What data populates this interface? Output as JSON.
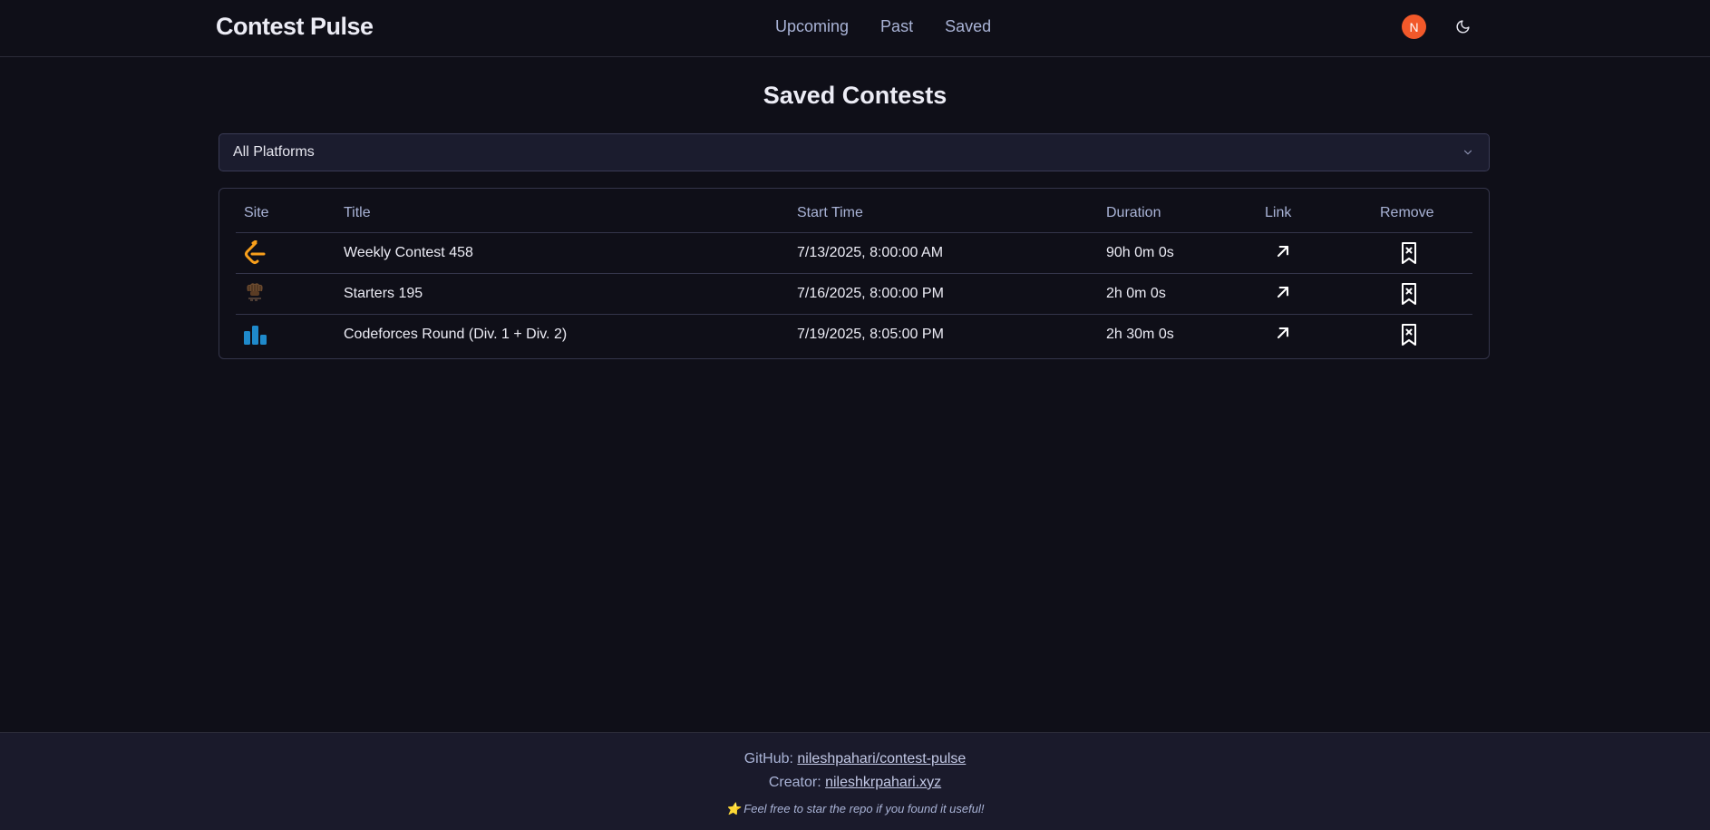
{
  "app": {
    "brand": "Contest Pulse"
  },
  "nav": {
    "items": [
      "Upcoming",
      "Past",
      "Saved"
    ]
  },
  "user": {
    "avatar_letter": "N",
    "avatar_color": "#f2592a"
  },
  "page": {
    "title": "Saved Contests"
  },
  "filter": {
    "selected": "All Platforms"
  },
  "table": {
    "headers": {
      "site": "Site",
      "title": "Title",
      "start": "Start Time",
      "duration": "Duration",
      "link": "Link",
      "remove": "Remove"
    },
    "rows": [
      {
        "site": "leetcode-icon",
        "title": "Weekly Contest 458",
        "start": "7/13/2025, 8:00:00 AM",
        "duration": "90h 0m 0s"
      },
      {
        "site": "codechef-icon",
        "title": "Starters 195",
        "start": "7/16/2025, 8:00:00 PM",
        "duration": "2h 0m 0s"
      },
      {
        "site": "codeforces-icon",
        "title": "Codeforces Round (Div. 1 + Div. 2)",
        "start": "7/19/2025, 8:05:00 PM",
        "duration": "2h 30m 0s"
      }
    ]
  },
  "footer": {
    "github_prefix": "GitHub:",
    "github_link": "nileshpahari/contest-pulse",
    "creator_prefix": "Creator:",
    "creator_link": "nileshkrpahari.xyz",
    "note": "⭐ Feel free to star the repo if you found it useful!"
  },
  "colors": {
    "background": "#0f0f18",
    "surface": "#1b1c2e",
    "border": "#34354a",
    "muted_text": "#a9b3d6",
    "leetcode": "#f89f1b",
    "codeforces": "#1f8acb"
  }
}
